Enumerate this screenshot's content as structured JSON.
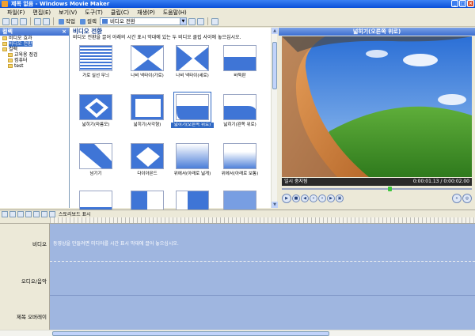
{
  "window": {
    "title": "제목 없음 - Windows Movie Maker"
  },
  "menu": [
    "파일(F)",
    "편집(E)",
    "보기(V)",
    "도구(T)",
    "클립(C)",
    "재생(P)",
    "도움말(H)"
  ],
  "toolbar": {
    "tasks_label": "작업",
    "collections_label": "컬렉",
    "combo_value": "비디오 전환"
  },
  "tasks_pane": {
    "header": "컬렉",
    "items": [
      {
        "label": "비디오 효과",
        "level": 1
      },
      {
        "label": "비디오 전환",
        "level": 1,
        "selected": true
      },
      {
        "label": "컬렉",
        "level": 1
      },
      {
        "label": "교육용 점검",
        "level": 2
      },
      {
        "label": "컴퓨터",
        "level": 2
      },
      {
        "label": "test",
        "level": 2
      }
    ]
  },
  "gallery": {
    "title": "비디오 전환",
    "description": "비디오 전환을 끌어 아래의 시간 표시 막대에 있는 두 비디오 클립 사이에 놓으십시오.",
    "tiles": [
      {
        "label": "가로 실선 무늬",
        "pattern": "stripes"
      },
      {
        "label": "나비 넥타이(가로)",
        "pattern": "bowtie-h"
      },
      {
        "label": "나비 넥타이(세로)",
        "pattern": "bowtie-v"
      },
      {
        "label": "바둑판",
        "pattern": "bar-top"
      },
      {
        "label": "넓히기(마름모)",
        "pattern": "diamond-x"
      },
      {
        "label": "넓히기(사각형)",
        "pattern": "rect"
      },
      {
        "label": "넓히기(오른쪽 위로)",
        "pattern": "curl-bl",
        "selected": true
      },
      {
        "label": "넓히기(왼쪽 위로)",
        "pattern": "curl-br"
      },
      {
        "label": "넘기기",
        "pattern": "diag"
      },
      {
        "label": "다이아몬드",
        "pattern": "diamond"
      },
      {
        "label": "위에서(아래로 넓게)",
        "pattern": "fade-down"
      },
      {
        "label": "위에서(아래로 보통)",
        "pattern": "fade-down2"
      },
      {
        "label": "",
        "pattern": "strip"
      },
      {
        "label": "",
        "pattern": "vbar"
      },
      {
        "label": "",
        "pattern": "vbar2"
      },
      {
        "label": "",
        "pattern": "vbar3"
      }
    ]
  },
  "monitor": {
    "title": "넓히기(오른쪽 위로)",
    "status": "일시 중지됨",
    "time": "0:00:01.13 / 0:00:02.00",
    "seek_fraction": 0.57
  },
  "timeline": {
    "toolbar_label": "스토리보드 표시",
    "video_track_label": "비디오",
    "video_hint": "동영상을 만들려면 미디어를 시간 표시 막대에 끌어 놓으십시오.",
    "audio_track_label": "오디오/음악",
    "title_track_label": "제목 오버레이"
  }
}
